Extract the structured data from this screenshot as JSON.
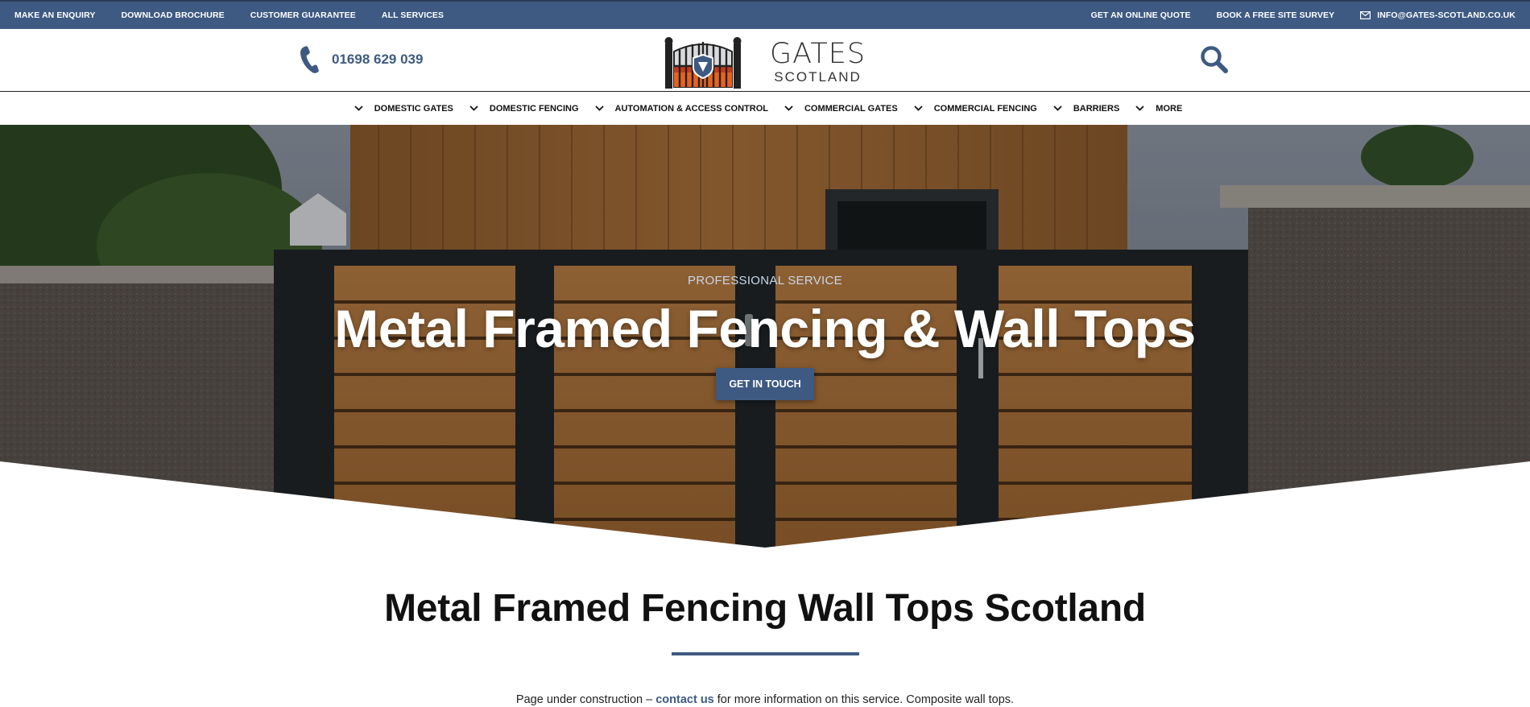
{
  "topbar": {
    "left_links": [
      "MAKE AN ENQUIRY",
      "DOWNLOAD BROCHURE",
      "CUSTOMER GUARANTEE",
      "ALL SERVICES"
    ],
    "right_links": [
      "GET AN ONLINE QUOTE",
      "BOOK A FREE SITE SURVEY"
    ],
    "email": "INFO@GATES-SCOTLAND.CO.UK"
  },
  "header": {
    "phone": "01698 629 039",
    "logo_line1": "GATES",
    "logo_line2": "SCOTLAND"
  },
  "nav": {
    "items": [
      "DOMESTIC GATES",
      "DOMESTIC FENCING",
      "AUTOMATION & ACCESS CONTROL",
      "COMMERCIAL GATES",
      "COMMERCIAL FENCING",
      "BARRIERS",
      "MORE"
    ]
  },
  "hero": {
    "subtitle": "PROFESSIONAL SERVICE",
    "title": "Metal Framed Fencing & Wall Tops",
    "button": "GET IN TOUCH"
  },
  "content": {
    "title": "Metal Framed Fencing Wall Tops Scotland",
    "text_before": "Page under construction – ",
    "link": "contact us",
    "text_after": " for more information on this service. Composite wall tops."
  },
  "colors": {
    "brand": "#3e5a82",
    "topbar": "#3e5a82"
  }
}
